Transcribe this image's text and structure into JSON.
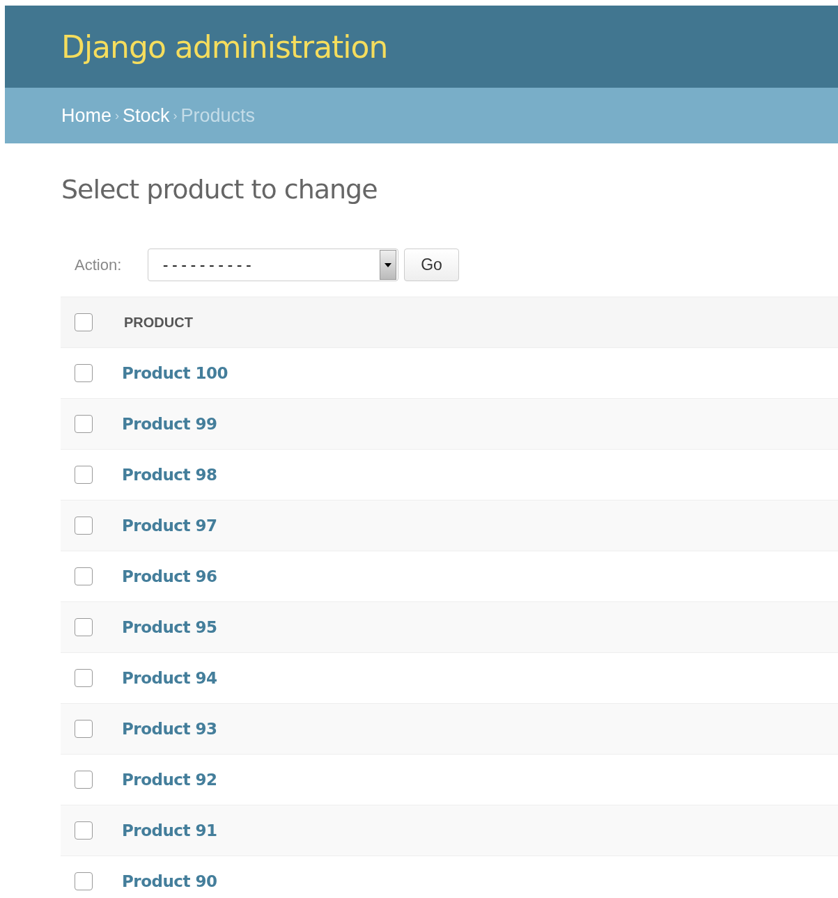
{
  "site_title": "Django administration",
  "breadcrumbs": [
    {
      "label": "Home",
      "current": false
    },
    {
      "separator": "›",
      "label": "Stock",
      "current": false
    },
    {
      "separator": "›",
      "label": "Products",
      "current": true
    }
  ],
  "heading": "Select product to change",
  "action_bar": {
    "label": "Action:",
    "value": "----------",
    "button": "Go"
  },
  "table": {
    "select_all": {
      "checked": false
    },
    "columns": [
      "PRODUCT"
    ],
    "rows": [
      {
        "label": "Product 100",
        "checked": false
      },
      {
        "label": "Product 99",
        "checked": false
      },
      {
        "label": "Product 98",
        "checked": false
      },
      {
        "label": "Product 97",
        "checked": false
      },
      {
        "label": "Product 96",
        "checked": false
      },
      {
        "label": "Product 95",
        "checked": false
      },
      {
        "label": "Product 94",
        "checked": false
      },
      {
        "label": "Product 93",
        "checked": false
      },
      {
        "label": "Product 92",
        "checked": false
      },
      {
        "label": "Product 91",
        "checked": false
      },
      {
        "label": "Product 90",
        "checked": false
      }
    ]
  }
}
